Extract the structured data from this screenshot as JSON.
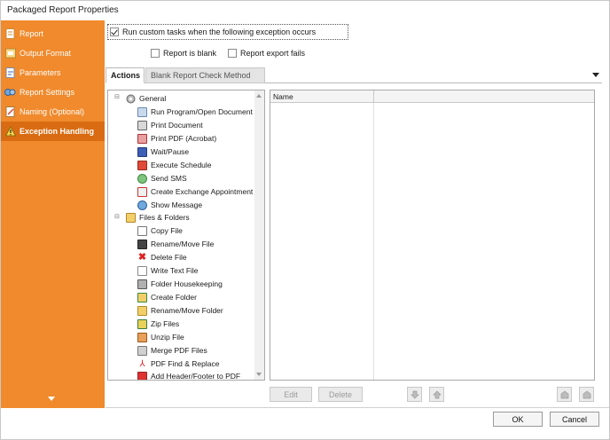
{
  "window": {
    "title": "Packaged Report Properties"
  },
  "sidebar": {
    "items": [
      {
        "label": "Report",
        "icon": "report-icon"
      },
      {
        "label": "Output Format",
        "icon": "output-format-icon"
      },
      {
        "label": "Parameters",
        "icon": "parameters-icon"
      },
      {
        "label": "Report Settings",
        "icon": "report-settings-icon"
      },
      {
        "label": "Naming (Optional)",
        "icon": "naming-icon"
      },
      {
        "label": "Exception Handling",
        "icon": "warning-icon"
      }
    ]
  },
  "options": {
    "custom_tasks": {
      "label": "Run custom tasks when the following exception occurs",
      "checked": true
    },
    "report_blank": {
      "label": "Report is blank",
      "checked": false
    },
    "export_fails": {
      "label": "Report export fails",
      "checked": false
    }
  },
  "tabs": [
    {
      "label": "Actions"
    },
    {
      "label": "Blank Report Check Method"
    }
  ],
  "tree": {
    "groups": [
      {
        "label": "General",
        "items": [
          "Run Program/Open Document",
          "Print Document",
          "Print PDF (Acrobat)",
          "Wait/Pause",
          "Execute Schedule",
          "Send SMS",
          "Create Exchange Appointment",
          "Show Message"
        ]
      },
      {
        "label": "Files & Folders",
        "items": [
          "Copy File",
          "Rename/Move File",
          "Delete File",
          "Write Text File",
          "Folder Housekeeping",
          "Create Folder",
          "Rename/Move Folder",
          "Zip Files",
          "Unzip File",
          "Merge PDF Files",
          "PDF Find & Replace",
          "Add Header/Footer to PDF"
        ]
      }
    ]
  },
  "grid": {
    "columns": [
      "Name"
    ]
  },
  "buttons": {
    "edit": "Edit",
    "delete": "Delete",
    "ok": "OK",
    "cancel": "Cancel"
  },
  "colors": {
    "sidebar": "#f08a2c",
    "sidebar_active": "#d96c12"
  }
}
